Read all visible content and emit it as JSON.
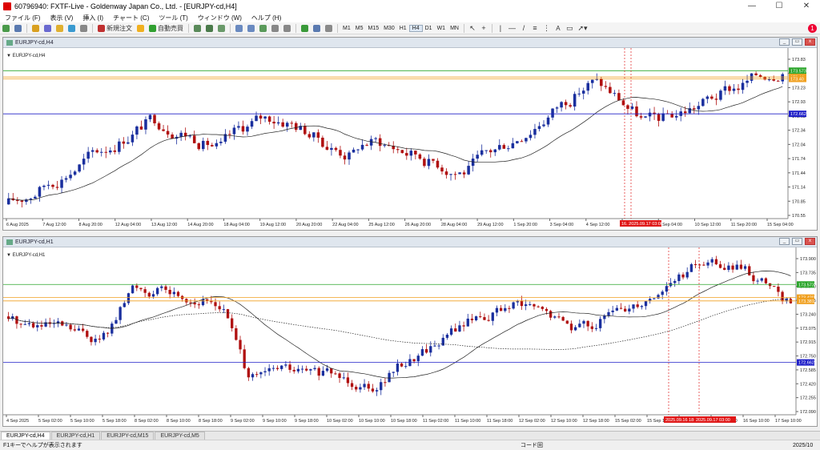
{
  "window": {
    "title": "60796940: FXTF-Live - Goldenway Japan Co., Ltd. - [EURJPY-cd,H4]",
    "min_glyph": "—",
    "max_glyph": "☐",
    "close_glyph": "✕"
  },
  "menu": [
    "ファイル (F)",
    "表示 (V)",
    "挿入 (I)",
    "チャート (C)",
    "ツール (T)",
    "ウィンドウ (W)",
    "ヘルプ (H)"
  ],
  "toolbar": {
    "new_order": "新規注文",
    "auto_trade": "自動売買",
    "timeframes": [
      "M1",
      "M5",
      "M15",
      "M30",
      "H1",
      "H4",
      "D1",
      "W1",
      "MN"
    ],
    "active_timeframe": "H4",
    "text_tool": "A",
    "notification_count": "1"
  },
  "chart_h4": {
    "window_title": "EURJPY-cd,H4",
    "symbol_label": "EURJPY-cd,H4",
    "price_labels": [
      "173.83",
      "173.53",
      "173.23",
      "172.93",
      "172.63",
      "172.34",
      "172.04",
      "171.74",
      "171.44",
      "171.14",
      "170.85",
      "170.55"
    ],
    "level_tags": [
      {
        "value": 173.573,
        "label": "173.573",
        "color": "#2aa52a"
      },
      {
        "value": 173.44,
        "label": "173.44",
        "color": "#f0a020"
      },
      {
        "value": 173.4,
        "label": "173.40",
        "color": "#f0a020"
      },
      {
        "value": 172.662,
        "label": "172.662",
        "color": "#2020c8"
      }
    ],
    "time_labels": [
      "6 Aug 2025",
      "7 Aug 12:00",
      "8 Aug 20:00",
      "12 Aug 04:00",
      "13 Aug 12:00",
      "14 Aug 20:00",
      "18 Aug 04:00",
      "19 Aug 12:00",
      "20 Aug 20:00",
      "22 Aug 04:00",
      "25 Aug 12:00",
      "26 Aug 20:00",
      "28 Aug 04:00",
      "29 Aug 12:00",
      "1 Sep 20:00",
      "3 Sep 04:00",
      "4 Sep 12:00",
      "5 Sep 20:00",
      "9 Sep 04:00",
      "10 Sep 12:00",
      "11 Sep 20:00",
      "15 Sep 04:00"
    ],
    "time_tag": "16. 2025.09.17 03:00"
  },
  "chart_h1": {
    "window_title": "EURJPY-cd,H1",
    "symbol_label": "EURJPY-cd,H1",
    "price_labels": [
      "173.900",
      "173.735",
      "173.570",
      "173.405",
      "173.240",
      "173.075",
      "172.915",
      "172.750",
      "172.585",
      "172.420",
      "172.255",
      "172.090"
    ],
    "level_tags": [
      {
        "value": 173.573,
        "label": "173.573",
        "color": "#2aa52a"
      },
      {
        "value": 173.42,
        "label": "173.420",
        "color": "#f0a020"
      },
      {
        "value": 173.381,
        "label": "173.381",
        "color": "#f0a020"
      },
      {
        "value": 172.662,
        "label": "172.662",
        "color": "#2020c8"
      }
    ],
    "time_labels": [
      "4 Sep 2025",
      "5 Sep 02:00",
      "5 Sep 10:00",
      "5 Sep 18:00",
      "8 Sep 02:00",
      "8 Sep 10:00",
      "8 Sep 18:00",
      "9 Sep 02:00",
      "9 Sep 10:00",
      "9 Sep 18:00",
      "10 Sep 02:00",
      "10 Sep 10:00",
      "10 Sep 18:00",
      "11 Sep 02:00",
      "11 Sep 10:00",
      "11 Sep 18:00",
      "12 Sep 02:00",
      "12 Sep 10:00",
      "12 Sep 18:00",
      "15 Sep 02:00",
      "15 Sep 10:00",
      "15 Sep 18:00",
      "16 Sep 02:00",
      "16 Sep 10:00",
      "17 Sep 10:00"
    ],
    "time_tags": [
      "2025.09.16 18:0",
      "2025.09.17 03:00"
    ]
  },
  "tabs": [
    "EURJPY-cd,H4",
    "EURJPY-cd,H1",
    "EURJPY-cd,M15",
    "EURJPY-cd,M5"
  ],
  "active_tab": "EURJPY-cd,H4",
  "status": {
    "help": "F1キーでヘルプが表示されます",
    "profile": "コード回",
    "date": "2025/10"
  },
  "colors": {
    "bull": "#1a2f9e",
    "bear": "#b01010",
    "green_level": "#2aa52a",
    "orange_level": "#f0a020",
    "blue_level": "#2020c8",
    "ma": "#222222",
    "vline": "#e02020"
  }
}
